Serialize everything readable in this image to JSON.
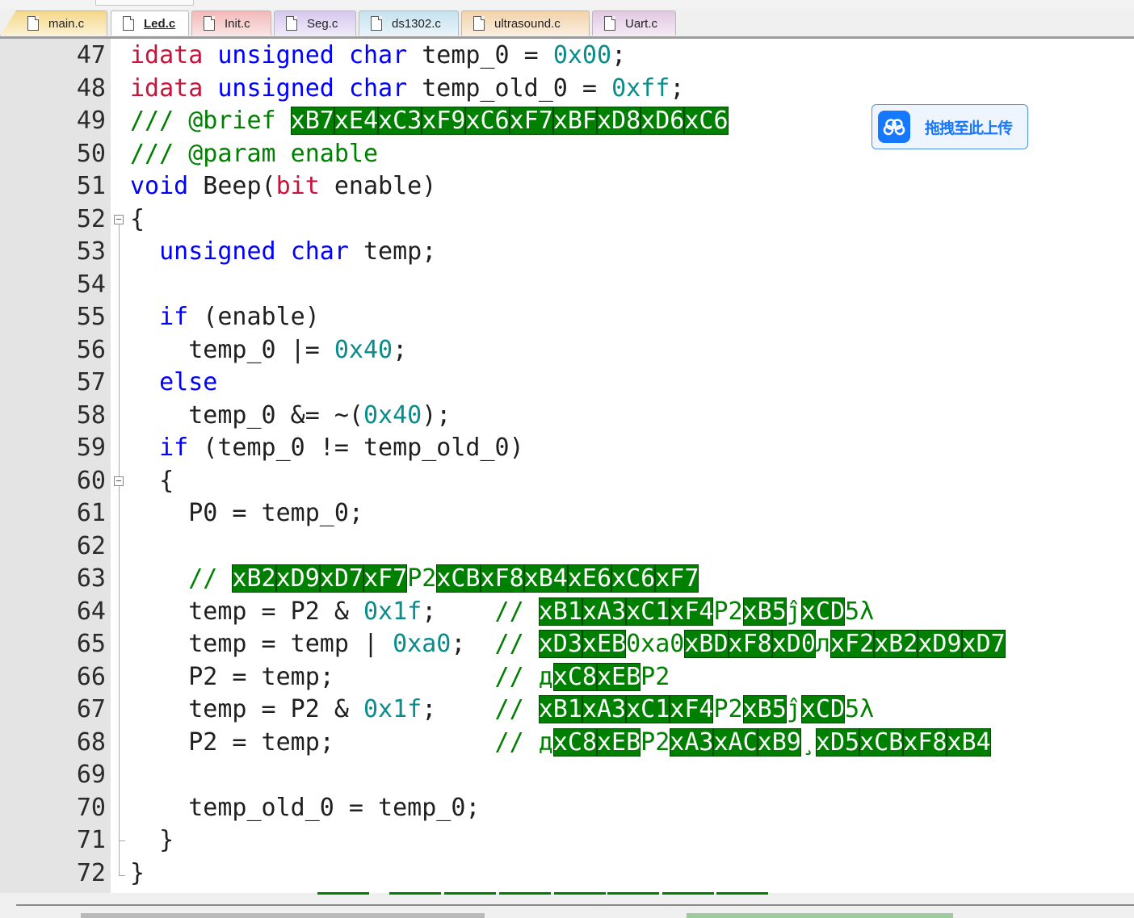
{
  "tabs": [
    {
      "label": "main.c",
      "color": "#f5d98a",
      "active": false
    },
    {
      "label": "Led.c",
      "color": "#ffffff",
      "active": true
    },
    {
      "label": "Init.c",
      "color": "#f2b9b9",
      "active": false
    },
    {
      "label": "Seg.c",
      "color": "#d6c8ef",
      "active": false
    },
    {
      "label": "ds1302.c",
      "color": "#c5e2ef",
      "active": false
    },
    {
      "label": "ultrasound.c",
      "color": "#f2d2aa",
      "active": false
    },
    {
      "label": "Uart.c",
      "color": "#e2c8e2",
      "active": false
    }
  ],
  "editor": {
    "lines": [
      {
        "n": "47",
        "segs": [
          [
            "kw2",
            "idata"
          ],
          [
            "",
            "&#32;"
          ],
          [
            "kw",
            "unsigned"
          ],
          [
            "",
            "&#32;"
          ],
          [
            "kw",
            "char"
          ],
          [
            "",
            "&#32;temp_0&#32;=&#32;"
          ],
          [
            "num",
            "0x00"
          ],
          [
            "",
            ";"
          ]
        ]
      },
      {
        "n": "48",
        "segs": [
          [
            "kw2",
            "idata"
          ],
          [
            "",
            "&#32;"
          ],
          [
            "kw",
            "unsigned"
          ],
          [
            "",
            "&#32;"
          ],
          [
            "kw",
            "char"
          ],
          [
            "",
            "&#32;temp_old_0&#32;=&#32;"
          ],
          [
            "num",
            "0xff"
          ],
          [
            "",
            ";"
          ]
        ]
      },
      {
        "n": "49",
        "segs": [
          [
            "cmt",
            "///&#32;@brief&#32;"
          ],
          [
            "b",
            "xB7"
          ],
          [
            "b",
            "xE4"
          ],
          [
            "b",
            "xC3"
          ],
          [
            "b",
            "xF9"
          ],
          [
            "b",
            "xC6"
          ],
          [
            "b",
            "xF7"
          ],
          [
            "b",
            "xBF"
          ],
          [
            "b",
            "xD8"
          ],
          [
            "b",
            "xD6"
          ],
          [
            "b",
            "xC6"
          ]
        ]
      },
      {
        "n": "50",
        "segs": [
          [
            "cmt",
            "///&#32;@param&#32;enable"
          ]
        ]
      },
      {
        "n": "51",
        "segs": [
          [
            "kw",
            "void"
          ],
          [
            "",
            "&#32;Beep("
          ],
          [
            "kw2",
            "bit"
          ],
          [
            "",
            "&#32;enable)"
          ]
        ]
      },
      {
        "n": "52",
        "segs": [
          [
            "",
            "{"
          ]
        ]
      },
      {
        "n": "53",
        "segs": [
          [
            "",
            "&#32;&#32;"
          ],
          [
            "kw",
            "unsigned"
          ],
          [
            "",
            "&#32;"
          ],
          [
            "kw",
            "char"
          ],
          [
            "",
            "&#32;temp;"
          ]
        ]
      },
      {
        "n": "54",
        "segs": []
      },
      {
        "n": "55",
        "segs": [
          [
            "",
            "&#32;&#32;"
          ],
          [
            "kw",
            "if"
          ],
          [
            "",
            "&#32;(enable)"
          ]
        ]
      },
      {
        "n": "56",
        "segs": [
          [
            "",
            "&#32;&#32;&#32;&#32;temp_0&#32;|=&#32;"
          ],
          [
            "num",
            "0x40"
          ],
          [
            "",
            ";"
          ]
        ]
      },
      {
        "n": "57",
        "segs": [
          [
            "",
            "&#32;&#32;"
          ],
          [
            "kw",
            "else"
          ]
        ]
      },
      {
        "n": "58",
        "segs": [
          [
            "",
            "&#32;&#32;&#32;&#32;temp_0&#32;&amp;=&#32;~("
          ],
          [
            "num",
            "0x40"
          ],
          [
            "",
            ");"
          ]
        ]
      },
      {
        "n": "59",
        "segs": [
          [
            "",
            "&#32;&#32;"
          ],
          [
            "kw",
            "if"
          ],
          [
            "",
            "&#32;(temp_0&#32;!=&#32;temp_old_0)"
          ]
        ]
      },
      {
        "n": "60",
        "segs": [
          [
            "",
            "&#32;&#32;{"
          ]
        ]
      },
      {
        "n": "61",
        "segs": [
          [
            "",
            "&#32;&#32;&#32;&#32;P0&#32;=&#32;temp_0;"
          ]
        ]
      },
      {
        "n": "62",
        "segs": []
      },
      {
        "n": "63",
        "segs": [
          [
            "cmt",
            "&#32;&#32;&#32;&#32;//&#32;"
          ],
          [
            "b",
            "xB2"
          ],
          [
            "b",
            "xD9"
          ],
          [
            "b",
            "xD7"
          ],
          [
            "b",
            "xF7"
          ],
          [
            "ok",
            "P2"
          ],
          [
            "b",
            "xCB"
          ],
          [
            "b",
            "xF8"
          ],
          [
            "b",
            "xB4"
          ],
          [
            "b",
            "xE6"
          ],
          [
            "b",
            "xC6"
          ],
          [
            "b",
            "xF7"
          ]
        ]
      },
      {
        "n": "64",
        "segs": [
          [
            "",
            "&#32;&#32;&#32;&#32;temp&#32;=&#32;P2&#32;&amp;&#32;"
          ],
          [
            "num",
            "0x1f"
          ],
          [
            "",
            ";&#32;&#32;&#32;&#32;"
          ],
          [
            "cmt",
            "//&#32;"
          ],
          [
            "b",
            "xB1"
          ],
          [
            "b",
            "xA3"
          ],
          [
            "b",
            "xC1"
          ],
          [
            "b",
            "xF4"
          ],
          [
            "ok",
            "P2"
          ],
          [
            "b",
            "xB5"
          ],
          [
            "ok",
            "ĵ"
          ],
          [
            "b",
            "xCD"
          ],
          [
            "ok",
            "5λ"
          ]
        ]
      },
      {
        "n": "65",
        "segs": [
          [
            "",
            "&#32;&#32;&#32;&#32;temp&#32;=&#32;temp&#32;|&#32;"
          ],
          [
            "num",
            "0xa0"
          ],
          [
            "",
            ";&#32;&#32;"
          ],
          [
            "cmt",
            "//&#32;"
          ],
          [
            "b",
            "xD3"
          ],
          [
            "b",
            "xEB"
          ],
          [
            "ok",
            "0xa0"
          ],
          [
            "b",
            "xBD"
          ],
          [
            "b",
            "xF8"
          ],
          [
            "b",
            "xD0"
          ],
          [
            "ok",
            "л"
          ],
          [
            "b",
            "xF2"
          ],
          [
            "b",
            "xB2"
          ],
          [
            "b",
            "xD9"
          ],
          [
            "b",
            "xD7"
          ]
        ]
      },
      {
        "n": "66",
        "segs": [
          [
            "",
            "&#32;&#32;&#32;&#32;P2&#32;=&#32;temp;&#32;&#32;&#32;&#32;&#32;&#32;&#32;&#32;&#32;&#32;&#32;"
          ],
          [
            "cmt",
            "//&#32;"
          ],
          [
            "ok",
            "д"
          ],
          [
            "b",
            "xC8"
          ],
          [
            "b",
            "xEB"
          ],
          [
            "ok",
            "P2"
          ]
        ]
      },
      {
        "n": "67",
        "segs": [
          [
            "",
            "&#32;&#32;&#32;&#32;temp&#32;=&#32;P2&#32;&amp;&#32;"
          ],
          [
            "num",
            "0x1f"
          ],
          [
            "",
            ";&#32;&#32;&#32;&#32;"
          ],
          [
            "cmt",
            "//&#32;"
          ],
          [
            "b",
            "xB1"
          ],
          [
            "b",
            "xA3"
          ],
          [
            "b",
            "xC1"
          ],
          [
            "b",
            "xF4"
          ],
          [
            "ok",
            "P2"
          ],
          [
            "b",
            "xB5"
          ],
          [
            "ok",
            "ĵ"
          ],
          [
            "b",
            "xCD"
          ],
          [
            "ok",
            "5λ"
          ]
        ]
      },
      {
        "n": "68",
        "segs": [
          [
            "",
            "&#32;&#32;&#32;&#32;P2&#32;=&#32;temp;&#32;&#32;&#32;&#32;&#32;&#32;&#32;&#32;&#32;&#32;&#32;"
          ],
          [
            "cmt",
            "//&#32;"
          ],
          [
            "ok",
            "д"
          ],
          [
            "b",
            "xC8"
          ],
          [
            "b",
            "xEB"
          ],
          [
            "ok",
            "P2"
          ],
          [
            "b",
            "xA3"
          ],
          [
            "b",
            "xAC"
          ],
          [
            "b",
            "xB9"
          ],
          [
            "ok",
            "¸"
          ],
          [
            "b",
            "xD5"
          ],
          [
            "b",
            "xCB"
          ],
          [
            "b",
            "xF8"
          ],
          [
            "b",
            "xB4"
          ]
        ]
      },
      {
        "n": "69",
        "segs": []
      },
      {
        "n": "70",
        "segs": [
          [
            "",
            "&#32;&#32;&#32;&#32;temp_old_0&#32;=&#32;temp_0;"
          ]
        ]
      },
      {
        "n": "71",
        "segs": [
          [
            "",
            "&#32;&#32;}"
          ]
        ]
      },
      {
        "n": "72",
        "segs": [
          [
            "",
            "}"
          ]
        ]
      }
    ]
  },
  "upload_button": {
    "label": "拖拽至此上传",
    "icon": "cloud-icon",
    "color": "#1677ff"
  }
}
